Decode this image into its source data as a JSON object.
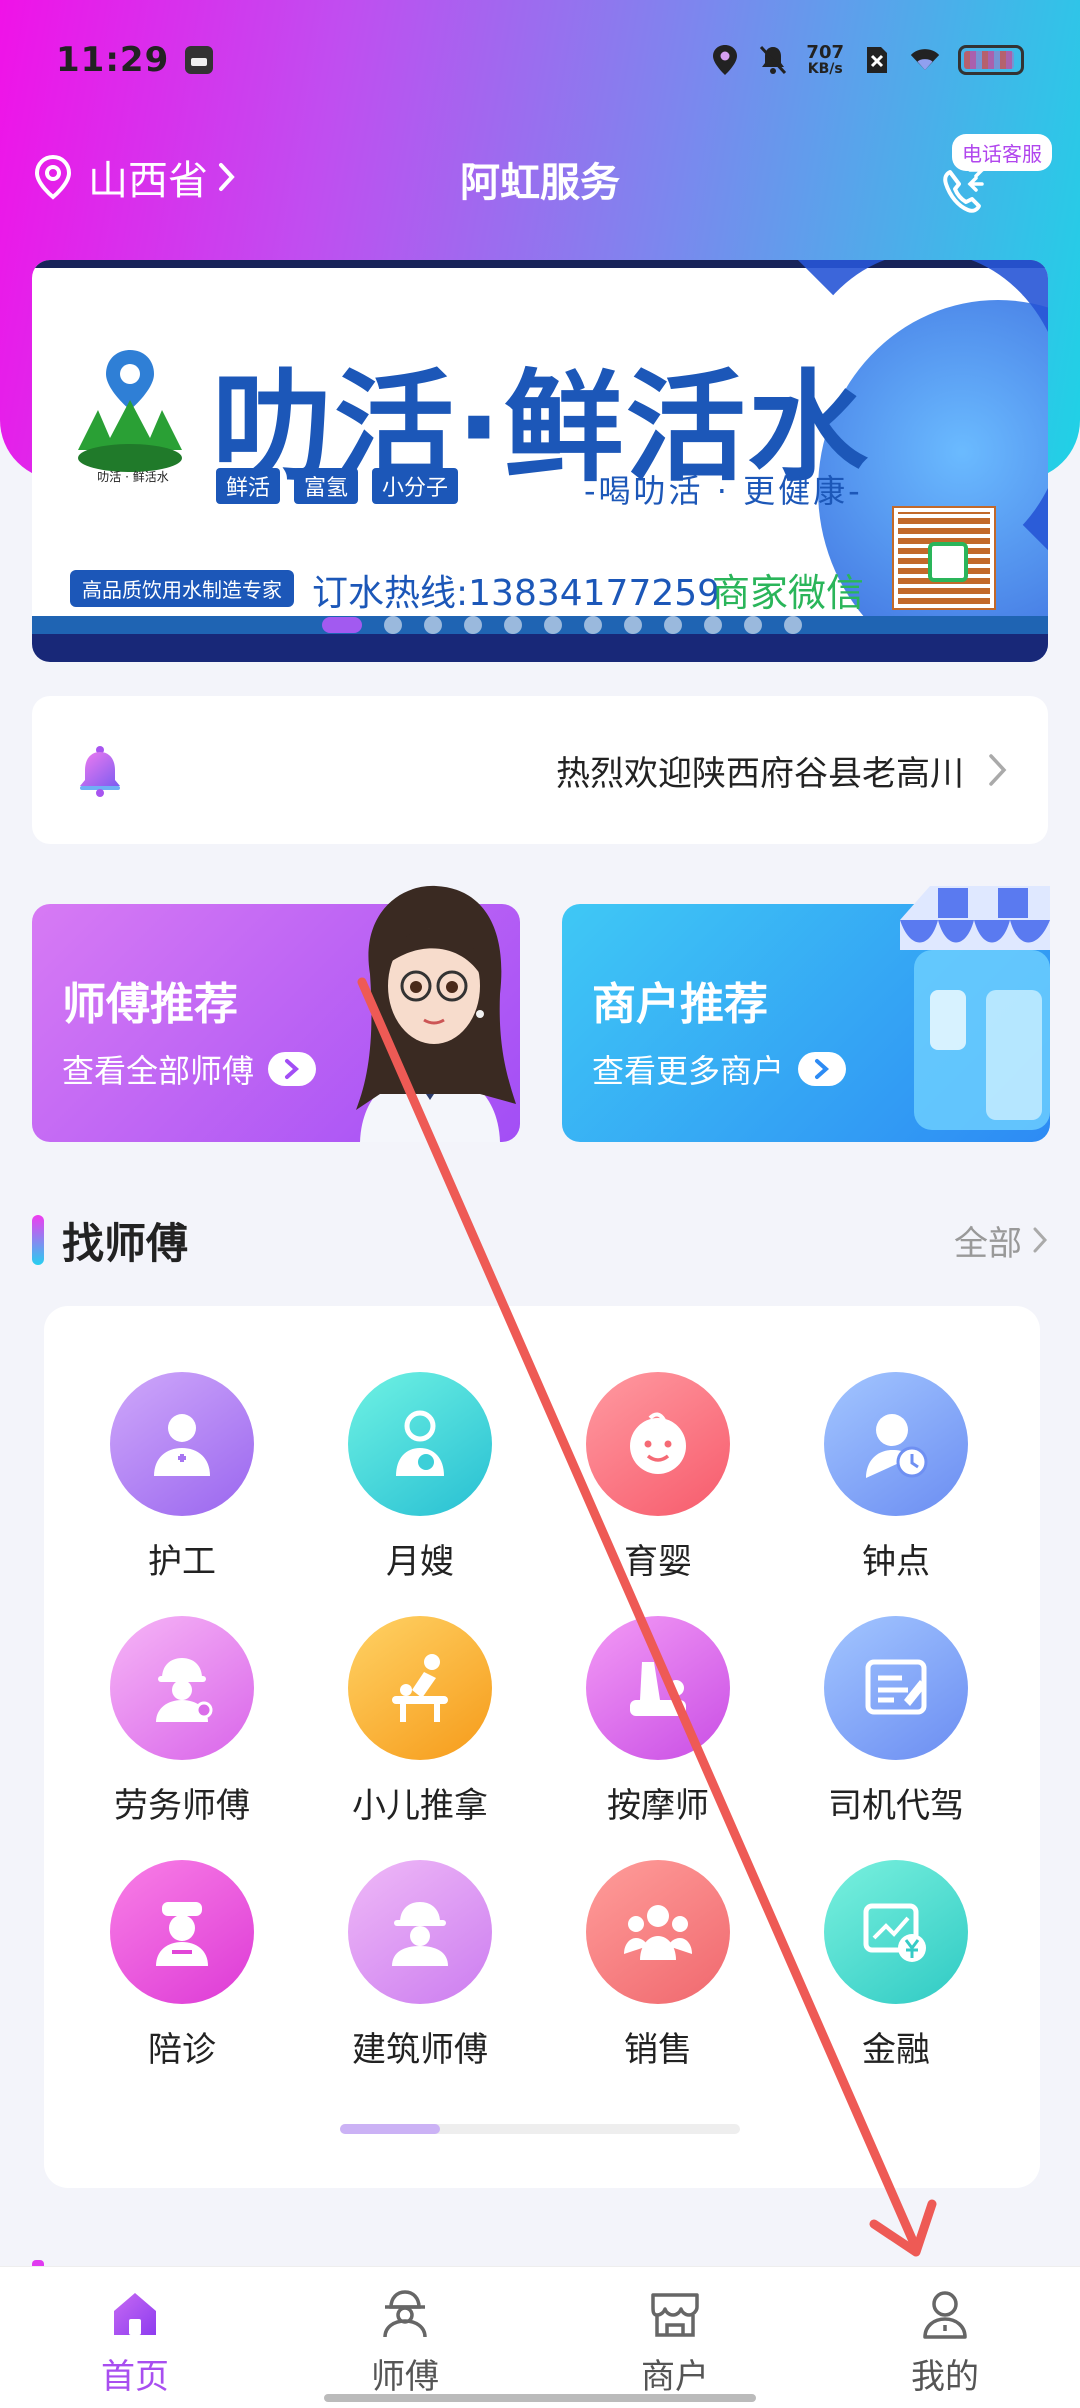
{
  "status_bar": {
    "time": "11:29",
    "net_speed_value": "707",
    "net_speed_unit": "KB/s"
  },
  "header": {
    "location": "山西省",
    "title": "阿虹服务",
    "service_badge": "电话客服"
  },
  "banner": {
    "headline": "叻活·鲜活水",
    "tags": [
      "鲜活",
      "富氢",
      "小分子"
    ],
    "slogan": "-喝叻活 · 更健康-",
    "logo_text": "叻活 · 鲜活水",
    "quality": "高品质饮用水制造专家",
    "hotline": "订水热线:13834177259",
    "wechat": "商家微信",
    "dots_total": 12,
    "dots_active": 0
  },
  "notice": {
    "text": "热烈欢迎陕西府谷县老高川"
  },
  "recommend": {
    "master_title": "师傅推荐",
    "master_sub": "查看全部师傅",
    "merchant_title": "商户推荐",
    "merchant_sub": "查看更多商户"
  },
  "section": {
    "title": "找师傅",
    "all": "全部"
  },
  "services": [
    {
      "label": "护工",
      "icon": "nurse-icon"
    },
    {
      "label": "月嫂",
      "icon": "maternity-icon"
    },
    {
      "label": "育婴",
      "icon": "baby-icon"
    },
    {
      "label": "钟点",
      "icon": "hourly-worker-icon"
    },
    {
      "label": "劳务师傅",
      "icon": "worker-icon"
    },
    {
      "label": "小儿推拿",
      "icon": "child-massage-icon"
    },
    {
      "label": "按摩师",
      "icon": "massage-icon"
    },
    {
      "label": "司机代驾",
      "icon": "driver-icon"
    },
    {
      "label": "陪诊",
      "icon": "escort-icon"
    },
    {
      "label": "建筑师傅",
      "icon": "builder-icon"
    },
    {
      "label": "销售",
      "icon": "sales-icon"
    },
    {
      "label": "金融",
      "icon": "finance-icon"
    }
  ],
  "tabs": [
    {
      "label": "首页",
      "icon": "home-icon",
      "active": true
    },
    {
      "label": "师傅",
      "icon": "master-icon",
      "active": false
    },
    {
      "label": "商户",
      "icon": "store-icon",
      "active": false
    },
    {
      "label": "我的",
      "icon": "profile-icon",
      "active": false
    }
  ],
  "colors": {
    "accent": "#a84ef0",
    "header_left": "#f012e8",
    "header_right": "#1fd2e6",
    "annotation": "#ee5a55"
  }
}
